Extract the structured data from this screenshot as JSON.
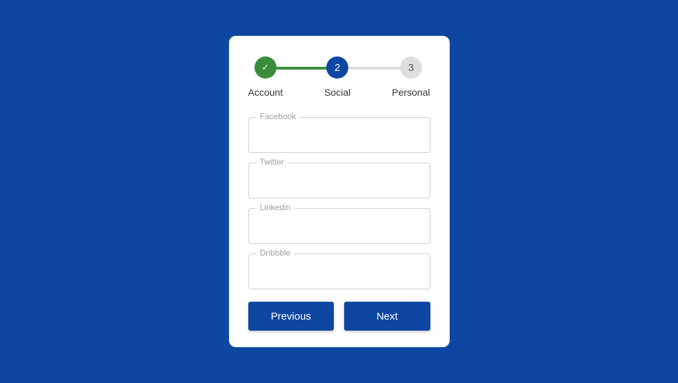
{
  "steps": [
    {
      "label": "Account",
      "indicator": "✓"
    },
    {
      "label": "Social",
      "indicator": "2"
    },
    {
      "label": "Personal",
      "indicator": "3"
    }
  ],
  "fields": {
    "facebook": {
      "label": "Facebook"
    },
    "twitter": {
      "label": "Twitter"
    },
    "linkedin": {
      "label": "Linkedin"
    },
    "dribbble": {
      "label": "Dribbble"
    }
  },
  "buttons": {
    "previous": "Previous",
    "next": "Next"
  }
}
